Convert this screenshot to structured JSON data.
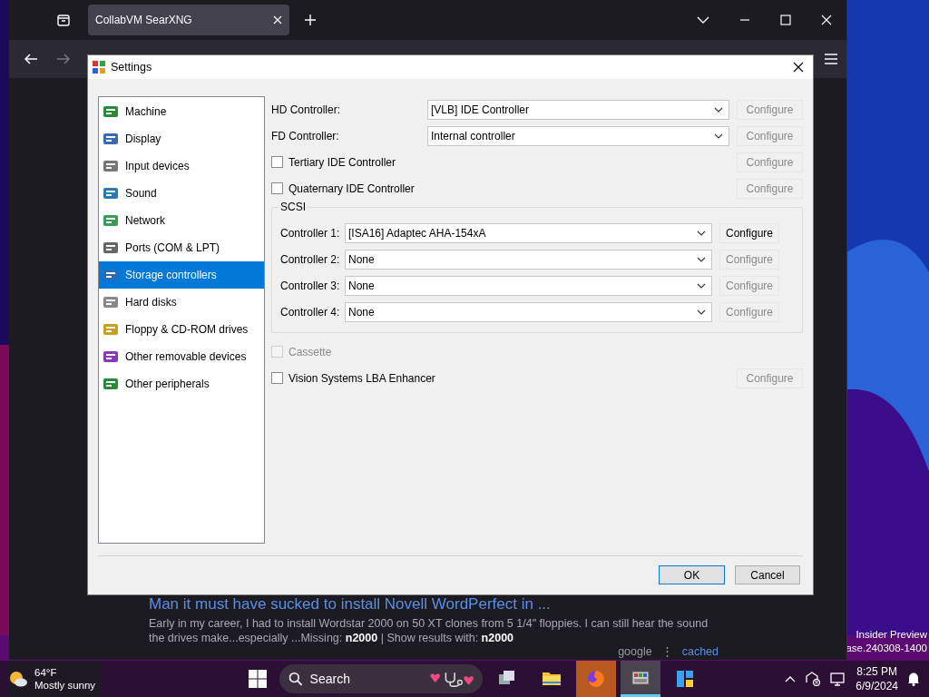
{
  "desktop": {
    "watermark_lines": [
      "Insider Preview",
      "ase.240308-1400"
    ]
  },
  "browser": {
    "tab": {
      "title": "CollabVM SearXNG"
    },
    "result": {
      "title": "Man it must have sucked to install Novell WordPerfect in ...",
      "snippet": "Early in my career, I had to install Wordstar 2000 on 50 XT clones from 5 1/4\" floppies. I can still hear the sound the drives make...especially ...Missing: **n2000** | Show results with: **n2000**",
      "engine": "google",
      "separator": "⋮",
      "cached": "cached"
    }
  },
  "dialog": {
    "title": "Settings",
    "categories": [
      {
        "label": "Machine",
        "selected": false
      },
      {
        "label": "Display",
        "selected": false
      },
      {
        "label": "Input devices",
        "selected": false
      },
      {
        "label": "Sound",
        "selected": false
      },
      {
        "label": "Network",
        "selected": false
      },
      {
        "label": "Ports (COM & LPT)",
        "selected": false
      },
      {
        "label": "Storage controllers",
        "selected": true
      },
      {
        "label": "Hard disks",
        "selected": false
      },
      {
        "label": "Floppy & CD-ROM drives",
        "selected": false
      },
      {
        "label": "Other removable devices",
        "selected": false
      },
      {
        "label": "Other peripherals",
        "selected": false
      }
    ],
    "rows": [
      {
        "kind": "select",
        "label": "HD Controller:",
        "value": "[VLB] IDE Controller",
        "configure": {
          "label": "Configure",
          "disabled": true
        }
      },
      {
        "kind": "select",
        "label": "FD Controller:",
        "value": "Internal controller",
        "configure": {
          "label": "Configure",
          "disabled": true
        }
      },
      {
        "kind": "checkbox",
        "label": "Tertiary IDE Controller",
        "checked": false,
        "disabled": false,
        "configure": {
          "label": "Configure",
          "disabled": true
        }
      },
      {
        "kind": "checkbox",
        "label": "Quaternary IDE Controller",
        "checked": false,
        "disabled": false,
        "configure": {
          "label": "Configure",
          "disabled": true
        }
      }
    ],
    "scsi": {
      "title": "SCSI",
      "controllers": [
        {
          "label": "Controller 1:",
          "value": "[ISA16] Adaptec AHA-154xA",
          "configure": {
            "label": "Configure",
            "disabled": false
          }
        },
        {
          "label": "Controller 2:",
          "value": "None",
          "configure": {
            "label": "Configure",
            "disabled": true
          }
        },
        {
          "label": "Controller 3:",
          "value": "None",
          "configure": {
            "label": "Configure",
            "disabled": true
          }
        },
        {
          "label": "Controller 4:",
          "value": "None",
          "configure": {
            "label": "Configure",
            "disabled": true
          }
        }
      ]
    },
    "extra_rows": [
      {
        "kind": "checkbox",
        "label": "Cassette",
        "checked": false,
        "disabled": true
      },
      {
        "kind": "checkbox",
        "label": "Vision Systems LBA Enhancer",
        "checked": false,
        "disabled": false,
        "configure": {
          "label": "Configure",
          "disabled": true
        }
      }
    ],
    "buttons": [
      {
        "label": "OK",
        "default": true
      },
      {
        "label": "Cancel",
        "default": false
      }
    ]
  },
  "taskbar": {
    "weather": {
      "temperature": "64°F",
      "condition": "Mostly sunny"
    },
    "search": {
      "placeholder": "Search"
    },
    "apps": [
      {
        "kind": "taskview",
        "flashing": false,
        "active": false
      },
      {
        "kind": "folder",
        "flashing": false,
        "active": false
      },
      {
        "kind": "browser",
        "flashing": true,
        "active": false
      },
      {
        "kind": "emulator",
        "flashing": false,
        "active": true
      },
      {
        "kind": "tiles",
        "flashing": false,
        "active": false
      }
    ],
    "clock": {
      "time": "8:25 PM",
      "date": "6/9/2024"
    }
  }
}
